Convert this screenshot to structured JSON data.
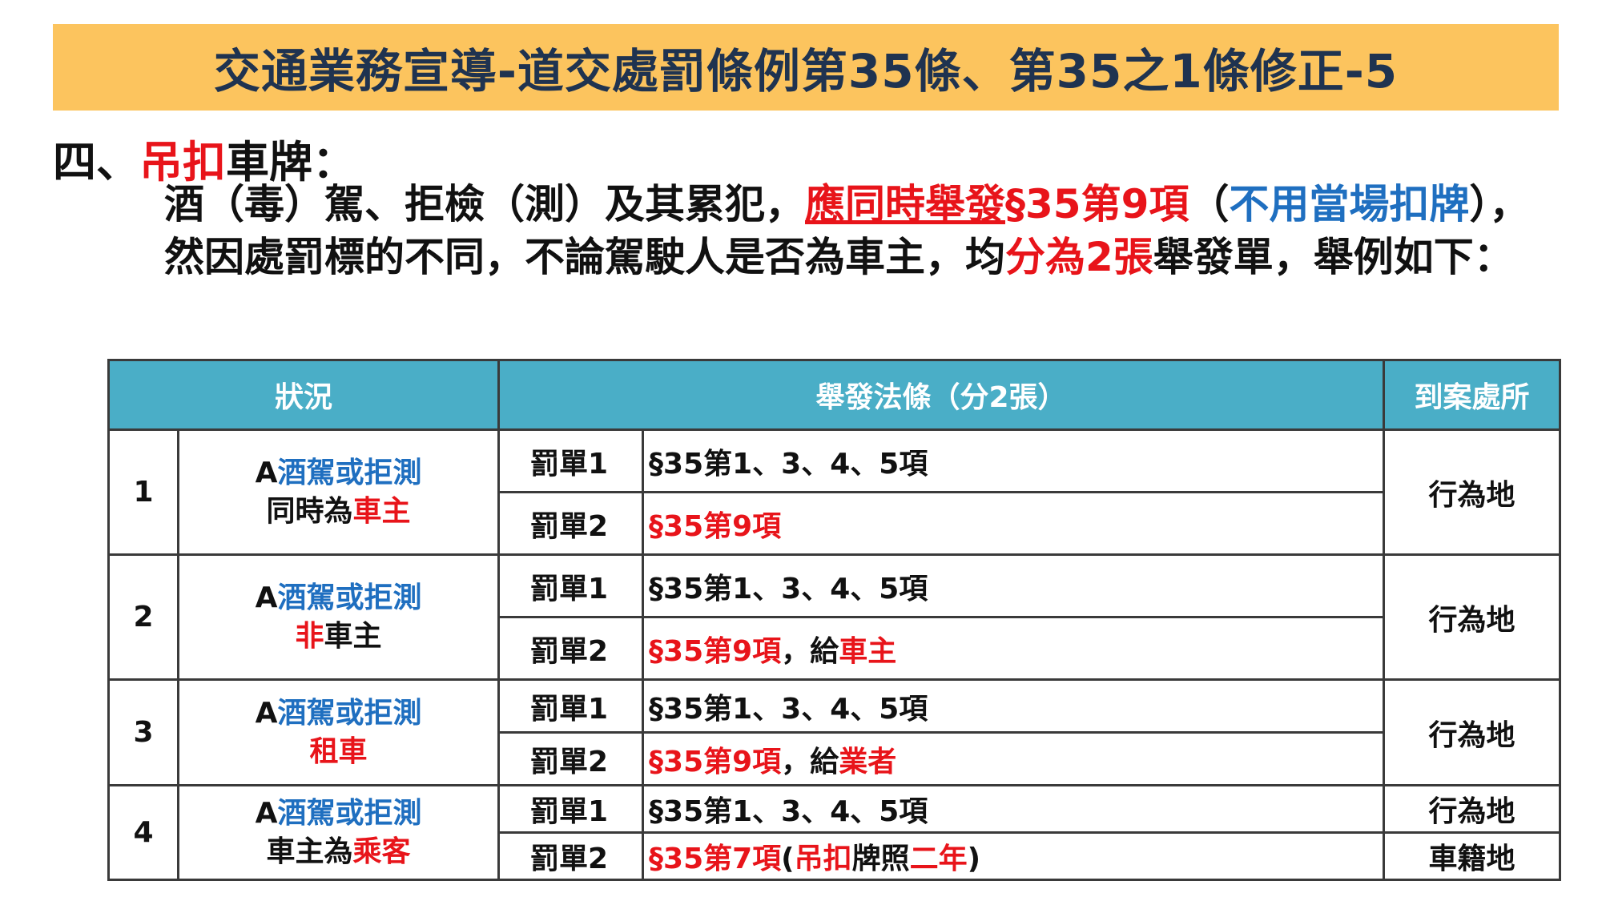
{
  "title": "交通業務宣導-道交處罰條例第35條、第35之1條修正-5",
  "section": {
    "prefix": "四、",
    "red": "吊扣",
    "rest": "車牌："
  },
  "para": {
    "p1": "酒（毒）駕、拒檢（測）及其累犯，",
    "p2": "應同時舉發",
    "p3": "§35第9項",
    "p4": "（",
    "p5": "不用當場扣牌",
    "p6": "），然因處罰標的不同，不論駕駛人是否為車主，均",
    "p7": "分為2張",
    "p8": "舉發單，舉例如下："
  },
  "table": {
    "headers": [
      "狀況",
      "舉發法條（分2張）",
      "到案處所"
    ],
    "rows": [
      {
        "num": "1",
        "a": "A",
        "act": "酒駕或拒測",
        "s1": "同時為",
        "s2": "車主",
        "s3": "",
        "t1": "罰單1",
        "law1": "§35第1、3、4、5項",
        "t2": "罰單2",
        "law2a": "§35第9項",
        "law2b": "",
        "law2c": "",
        "law2d": "",
        "law2e": "",
        "law2f": "",
        "place": "行為地"
      },
      {
        "num": "2",
        "a": "A",
        "act": "酒駕或拒測",
        "s1": "",
        "s2": "非",
        "s3": "車主",
        "t1": "罰單1",
        "law1": "§35第1、3、4、5項",
        "t2": "罰單2",
        "law2a": "§35第9項",
        "law2b": "，給",
        "law2c": "車主",
        "law2d": "",
        "law2e": "",
        "law2f": "",
        "place": "行為地"
      },
      {
        "num": "3",
        "a": "A",
        "act": "酒駕或拒測",
        "s1": "",
        "s2": "租車",
        "s3": "",
        "t1": "罰單1",
        "law1": "§35第1、3、4、5項",
        "t2": "罰單2",
        "law2a": "§35第9項",
        "law2b": "，給",
        "law2c": "業者",
        "law2d": "",
        "law2e": "",
        "law2f": "",
        "place": "行為地"
      },
      {
        "num": "4",
        "a": "A",
        "act": "酒駕或拒測",
        "s1": "車主為",
        "s2": "乘客",
        "s3": "",
        "t1": "罰單1",
        "law1": "§35第1、3、4、5項",
        "t2": "罰單2",
        "law2a": "§35第7項",
        "law2b": "(",
        "law2c": "吊扣",
        "law2d": "牌照",
        "law2e": "二年",
        "law2f": ")",
        "place": "行為地",
        "place2": "車籍地"
      }
    ]
  },
  "colors": {
    "title_bg": "#fcc45e",
    "header_bg": "#4aaec7",
    "red": "#e8141a",
    "blue": "#1f6fc0"
  }
}
